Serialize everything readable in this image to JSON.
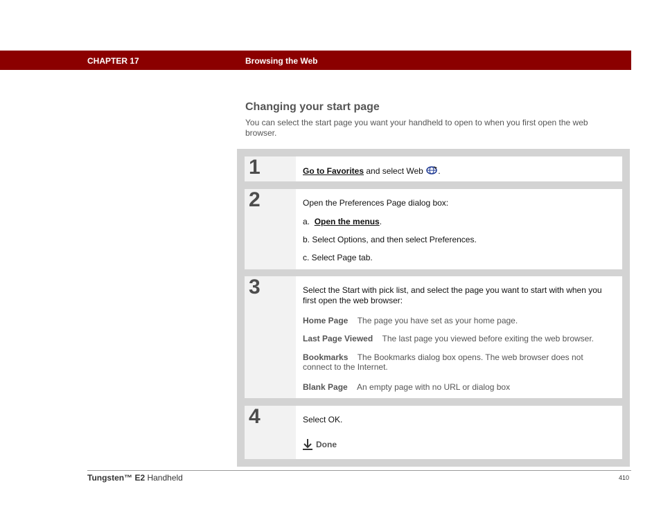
{
  "header": {
    "chapter": "CHAPTER 17",
    "title": "Browsing the Web"
  },
  "section": {
    "title": "Changing your start page",
    "intro": "You can select the start page you want your handheld to open to when you first open the web browser."
  },
  "steps": [
    {
      "number": "1",
      "link": "Go to Favorites",
      "text": " and select Web ",
      "tail": "."
    },
    {
      "number": "2",
      "lead": "Open the Preferences Page dialog box:",
      "a_prefix": "a.",
      "a_link": "Open the menus",
      "a_tail": ".",
      "b": "b.  Select Options, and then select Preferences.",
      "c": "c.  Select Page tab."
    },
    {
      "number": "3",
      "lead": "Select the Start with pick list, and select the page you want to start with when you first open the web browser:",
      "options": [
        {
          "term": "Home Page",
          "desc": "The page you have set as your home page."
        },
        {
          "term": "Last Page Viewed",
          "desc": "The last page you viewed before exiting the web browser."
        },
        {
          "term": "Bookmarks",
          "desc": "The Bookmarks dialog box opens. The web browser does not connect to the Internet."
        },
        {
          "term": "Blank Page",
          "desc": "An empty page with no URL or dialog box"
        }
      ]
    },
    {
      "number": "4",
      "lead": "Select OK.",
      "done": "Done"
    }
  ],
  "footer": {
    "product_bold": "Tungsten™ E2",
    "product_rest": " Handheld",
    "page": "410"
  },
  "icons": {
    "web": "web-browser-icon",
    "done": "down-arrow-icon"
  },
  "colors": {
    "header_bar": "#8b0000",
    "step_box": "#d3d3d3"
  }
}
